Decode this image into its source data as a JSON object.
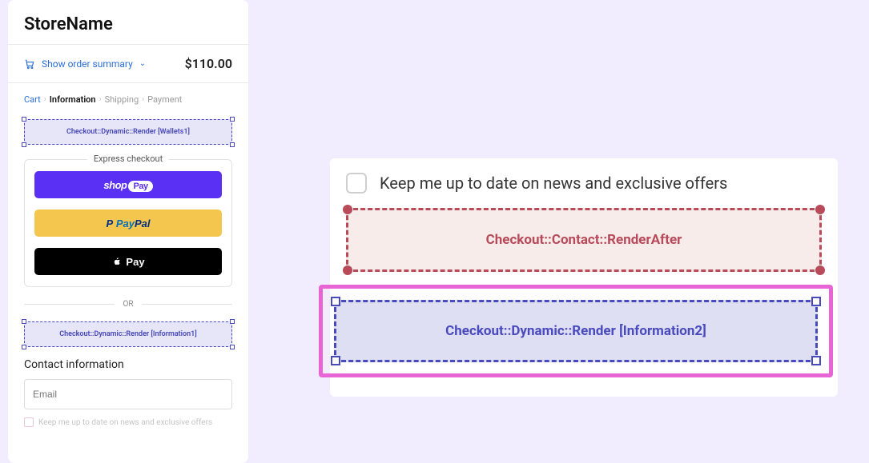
{
  "store_name": "StoreName",
  "summary": {
    "toggle_label": "Show order summary",
    "total": "$110.00"
  },
  "breadcrumb": {
    "cart": "Cart",
    "information": "Information",
    "shipping": "Shipping",
    "payment": "Payment"
  },
  "placeholders": {
    "wallets1": "Checkout::Dynamic::Render [Wallets1]",
    "information1": "Checkout::Dynamic::Render [Information1]"
  },
  "express": {
    "title": "Express checkout",
    "shop_label": "shop",
    "shop_pay": "Pay",
    "paypal_p": "P",
    "paypal_pay": "Pay",
    "paypal_pal": "Pal",
    "apple_pay": "Pay"
  },
  "or_label": "OR",
  "contact": {
    "title": "Contact information",
    "email_placeholder": "Email",
    "news_label": "Keep me up to date on news and exclusive offers"
  },
  "preview": {
    "news_label": "Keep me up to date on news and exclusive offers",
    "render_after": "Checkout::Contact::RenderAfter",
    "render_dynamic": "Checkout::Dynamic::Render [Information2]"
  }
}
